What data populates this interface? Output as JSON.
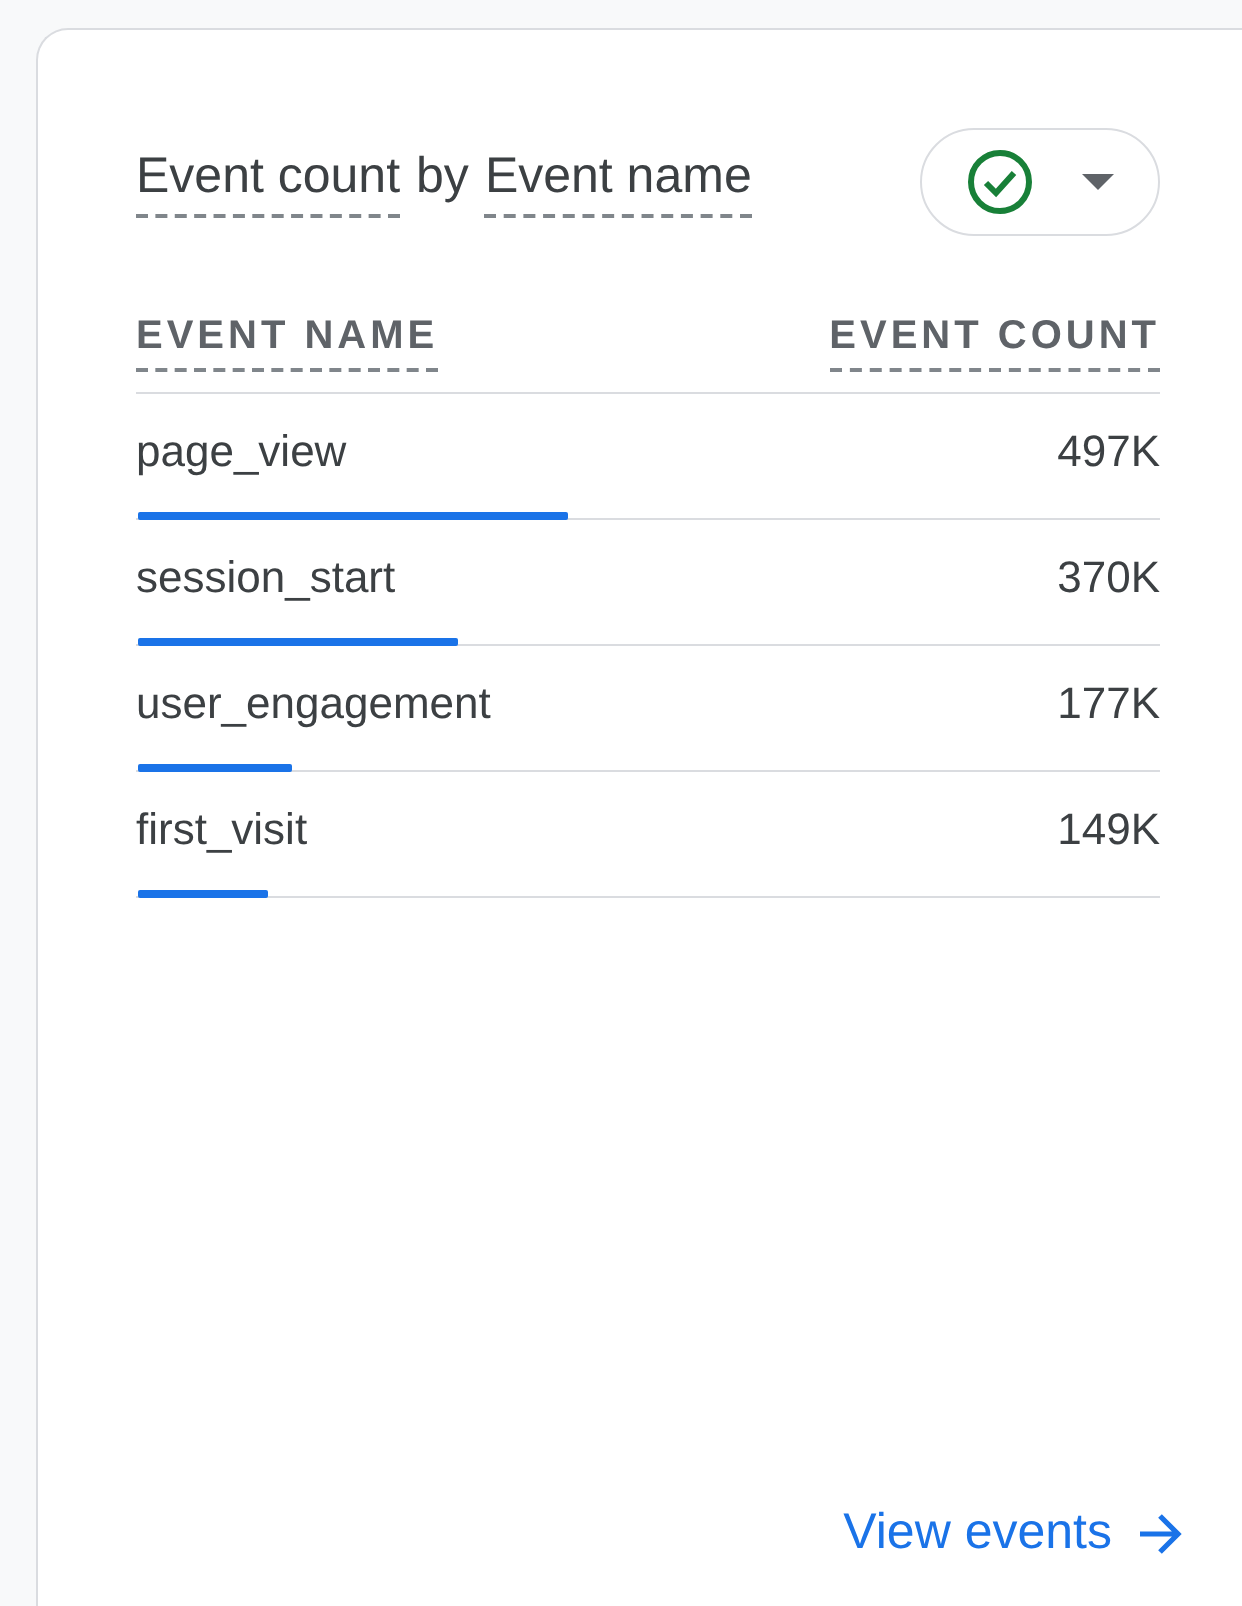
{
  "card": {
    "title_parts": [
      {
        "text": "Event count",
        "dotted": true
      },
      {
        "text": "by",
        "dotted": false
      },
      {
        "text": "Event name",
        "dotted": true
      }
    ],
    "status_button": {
      "checked": true
    },
    "table": {
      "columns": [
        "EVENT NAME",
        "EVENT COUNT"
      ],
      "rows": [
        {
          "name": "page_view",
          "count": "497K",
          "level": 0.42
        },
        {
          "name": "session_start",
          "count": "370K",
          "level": 0.313
        },
        {
          "name": "user_engagement",
          "count": "177K",
          "level": 0.15
        },
        {
          "name": "first_visit",
          "count": "149K",
          "level": 0.127
        }
      ]
    },
    "link": "View events"
  }
}
